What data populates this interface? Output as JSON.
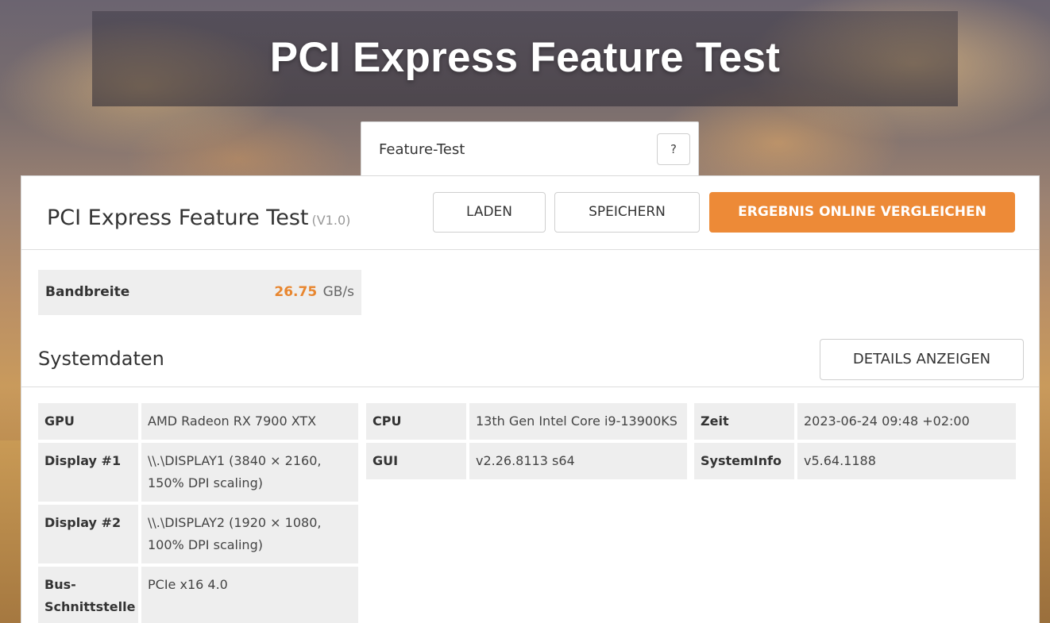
{
  "header": {
    "title": "PCI Express Feature Test"
  },
  "tab": {
    "label": "Feature-Test",
    "help_label": "?"
  },
  "test": {
    "name": "PCI Express Feature Test",
    "version": "(V1.0)",
    "buttons": {
      "load": "LADEN",
      "save": "SPEICHERN",
      "compare": "ERGEBNIS ONLINE VERGLEICHEN"
    }
  },
  "result": {
    "label": "Bandbreite",
    "value": "26.75",
    "unit": "GB/s"
  },
  "system": {
    "title": "Systemdaten",
    "details_button": "DETAILS ANZEIGEN",
    "col1": [
      {
        "key": "GPU",
        "value": "AMD Radeon RX 7900 XTX"
      },
      {
        "key": "Display #1",
        "value": "\\\\.\\DISPLAY1 (3840 × 2160, 150% DPI scaling)"
      },
      {
        "key": "Display #2",
        "value": "\\\\.\\DISPLAY2 (1920 × 1080, 100% DPI scaling)"
      },
      {
        "key": "Bus-Schnittstelle",
        "value": "PCIe x16 4.0"
      }
    ],
    "col2": [
      {
        "key": "CPU",
        "value": "13th Gen Intel Core i9-13900KS"
      },
      {
        "key": "GUI",
        "value": "v2.26.8113 s64"
      }
    ],
    "col3": [
      {
        "key": "Zeit",
        "value": "2023-06-24 09:48 +02:00"
      },
      {
        "key": "SystemInfo",
        "value": "v5.64.1188"
      }
    ]
  },
  "colors": {
    "accent": "#ed8a37",
    "value_highlight": "#e8862f"
  }
}
